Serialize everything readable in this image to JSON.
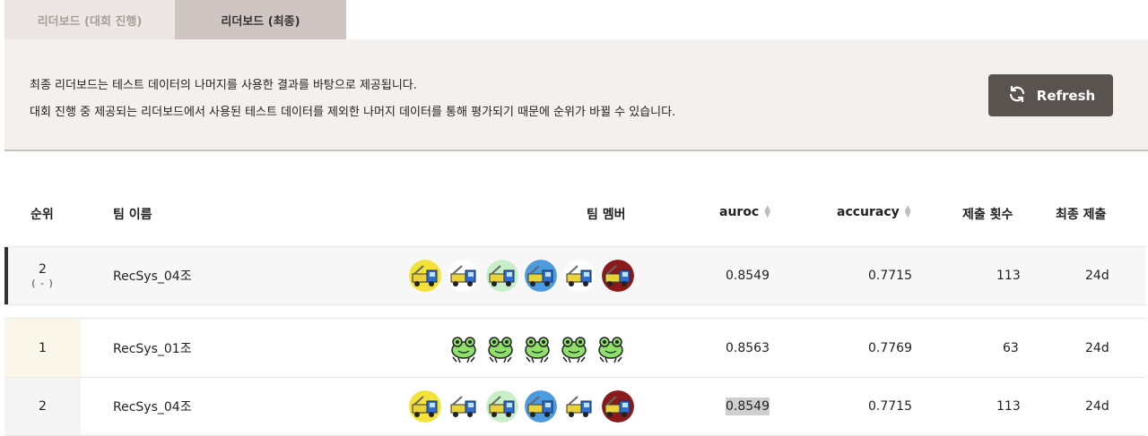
{
  "tabs": [
    {
      "label": "리더보드 (대회 진행)",
      "active": false
    },
    {
      "label": "리더보드 (최종)",
      "active": true
    }
  ],
  "info": {
    "line1": "최종 리더보드는 테스트 데이터의 나머지를 사용한 결과를 바탕으로 제공됩니다.",
    "line2": "대회 진행 중 제공되는 리더보드에서 사용된 테스트 데이터를 제외한 나머지 데이터를 통해 평가되기 때문에 순위가 바뀔 수 있습니다.",
    "refresh_label": "Refresh"
  },
  "table": {
    "headers": {
      "rank": "순위",
      "team": "팀 이름",
      "members": "팀 멤버",
      "auroc": "auroc",
      "accuracy": "accuracy",
      "submissions": "제출 횟수",
      "last": "최종 제출"
    },
    "my_row": {
      "rank": "2",
      "change": "( - )",
      "team": "RecSys_04조",
      "auroc": "0.8549",
      "accuracy": "0.7715",
      "submissions": "113",
      "last": "24d",
      "avatar_colors": [
        "#f2e23a",
        "#ffffff",
        "#c9efc9",
        "#4a9be0",
        "#ffffff",
        "#8b1a1a"
      ]
    },
    "rows": [
      {
        "rank": "1",
        "team": "RecSys_01조",
        "auroc": "0.8563",
        "accuracy": "0.7769",
        "submissions": "63",
        "last": "24d",
        "avatar_icon": "frog-icon",
        "avatar_count": 5
      },
      {
        "rank": "2",
        "team": "RecSys_04조",
        "auroc": "0.8549",
        "accuracy": "0.7715",
        "submissions": "113",
        "last": "24d",
        "avatar_colors": [
          "#f2e23a",
          "#ffffff",
          "#c9efc9",
          "#4a9be0",
          "#ffffff",
          "#8b1a1a"
        ]
      }
    ]
  }
}
